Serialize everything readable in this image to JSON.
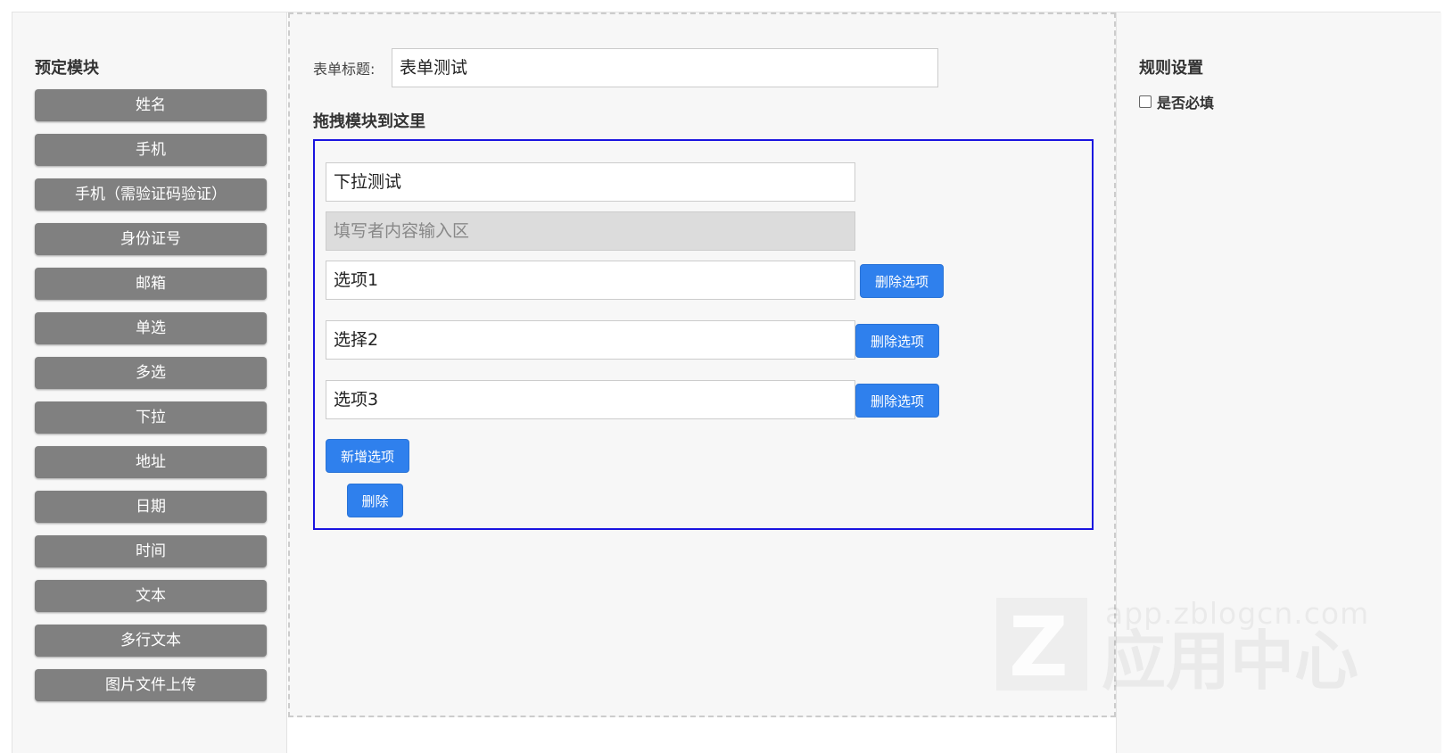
{
  "left_panel": {
    "title": "预定模块",
    "modules": [
      {
        "label": "姓名"
      },
      {
        "label": "手机"
      },
      {
        "label": "手机（需验证码验证）"
      },
      {
        "label": "身份证号"
      },
      {
        "label": "邮箱"
      },
      {
        "label": "单选"
      },
      {
        "label": "多选"
      },
      {
        "label": "下拉"
      },
      {
        "label": "地址"
      },
      {
        "label": "日期"
      },
      {
        "label": "时间"
      },
      {
        "label": "文本"
      },
      {
        "label": "多行文本"
      },
      {
        "label": "图片文件上传"
      }
    ]
  },
  "form": {
    "title_label": "表单标题:",
    "title_value": "表单测试",
    "drag_hint": "拖拽模块到这里"
  },
  "dropdown_field": {
    "name_value": "下拉测试",
    "content_placeholder": "填写者内容输入区",
    "options": [
      {
        "value": "选项1",
        "delete_label": "删除选项"
      },
      {
        "value": "选择2",
        "delete_label": "删除选项"
      },
      {
        "value": "选项3",
        "delete_label": "删除选项"
      }
    ],
    "add_option_label": "新增选项",
    "delete_label": "删除"
  },
  "right_panel": {
    "title": "规则设置",
    "required_label": "是否必填",
    "required_checked": false
  },
  "watermark": {
    "logo_letter": "Z",
    "url": "app.zblogcn.com",
    "text": "应用中心"
  },
  "colors": {
    "module_button": "#808080",
    "primary_button": "#2f80ed",
    "canvas_border": "#1a14e0",
    "panel_bg": "#f7f7f7"
  }
}
